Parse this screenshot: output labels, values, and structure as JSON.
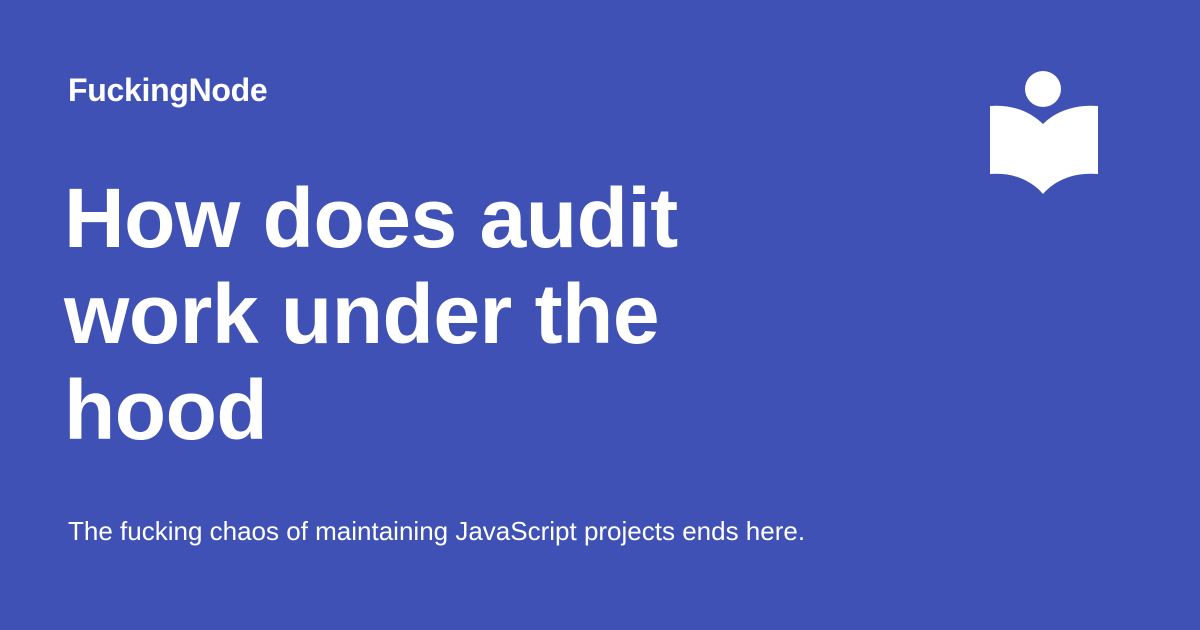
{
  "site": {
    "name": "FuckingNode"
  },
  "headline": {
    "lines": [
      "How does audit",
      "work under the",
      "hood"
    ]
  },
  "tagline": "The fucking chaos of maintaining JavaScript projects ends here.",
  "logo": {
    "icon": "reader-book-icon",
    "color": "#ffffff"
  },
  "colors": {
    "background": "#3f51b5",
    "text": "#ffffff"
  }
}
